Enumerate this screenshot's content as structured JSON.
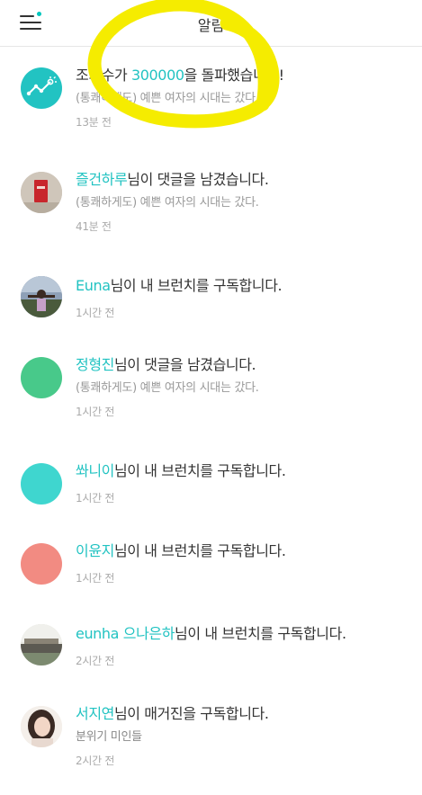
{
  "header": {
    "title": "알림"
  },
  "notifications": [
    {
      "highlight": "",
      "pre": "조회수가 ",
      "mid": "300000",
      "post": "을 돌파했습니다!",
      "sub": "(통쾌하게도) 예쁜 여자의 시대는 갔다.",
      "time": "13분 전"
    },
    {
      "highlight": "즐건하루",
      "text": "님이 댓글을 남겼습니다.",
      "sub": "(통쾌하게도) 예쁜 여자의 시대는 갔다.",
      "time": "41분 전"
    },
    {
      "highlight": "Euna",
      "text": "님이 내 브런치를 구독합니다.",
      "sub": "",
      "time": "1시간 전"
    },
    {
      "highlight": "정형진",
      "text": "님이 댓글을 남겼습니다.",
      "sub": "(통쾌하게도) 예쁜 여자의 시대는 갔다.",
      "time": "1시간 전"
    },
    {
      "highlight": "쏴니이",
      "text": "님이 내 브런치를 구독합니다.",
      "sub": "",
      "time": "1시간 전"
    },
    {
      "highlight": "이윤지",
      "text": "님이 내 브런치를 구독합니다.",
      "sub": "",
      "time": "1시간 전"
    },
    {
      "highlight": "eunha 으나은하",
      "text": "님이 내 브런치를 구독합니다.",
      "sub": "",
      "time": "2시간 전"
    },
    {
      "highlight": "서지연",
      "text": "님이 매거진을 구독합니다.",
      "sub": "분위기 미인들",
      "time": "2시간 전"
    }
  ],
  "colors": {
    "accent": "#22c3c2",
    "annotation": "#f5ec00",
    "green_avatar": "#48c98a",
    "teal_avatar": "#3fd6cf",
    "coral_avatar": "#f28b82"
  },
  "icons": {
    "menu": "hamburger-menu-icon",
    "stats": "chart-sparkle-icon"
  }
}
